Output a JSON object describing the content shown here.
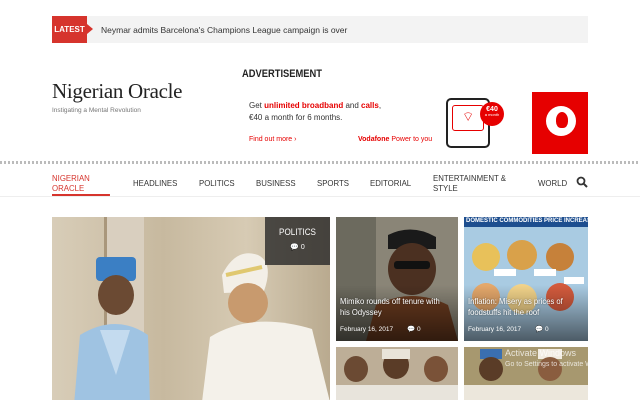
{
  "ticker": {
    "label": "LATEST",
    "headline": "Neymar admits Barcelona's Champions League campaign is over"
  },
  "brand": {
    "name": "Nigerian Oracle",
    "tagline": "Instigating a Mental Revolution"
  },
  "advert": {
    "heading": "ADVERTISEMENT",
    "line1_prefix": "Get ",
    "line1_highlight1": "unlimited broadband",
    "line1_mid": " and ",
    "line1_highlight2": "calls",
    "line1_suffix": ",",
    "line2": "€40 a month for 6 months.",
    "find_more": "Find out more ›",
    "brand": "Vodafone",
    "slogan": "Power to you",
    "price": "€40",
    "price_sub": "a month"
  },
  "nav": {
    "items": [
      {
        "label": "NIGERIAN ORACLE",
        "active": true
      },
      {
        "label": "HEADLINES"
      },
      {
        "label": "POLITICS"
      },
      {
        "label": "BUSINESS"
      },
      {
        "label": "SPORTS"
      },
      {
        "label": "EDITORIAL"
      },
      {
        "label": "ENTERTAINMENT & STYLE"
      },
      {
        "label": "WORLD"
      }
    ]
  },
  "featured": {
    "category": "POLITICS",
    "comments": "0"
  },
  "tiles": [
    {
      "title": "Mimiko rounds off tenure with his Odyssey",
      "date": "February 16, 2017",
      "comments": "0"
    },
    {
      "title": "Inflation: Misery as prices of foodstuffs hit the roof",
      "date": "February 16, 2017",
      "comments": "0",
      "banner": "DOMESTIC COMMODITIES PRICE INCREASE"
    },
    {
      "title": ""
    },
    {
      "title": ""
    }
  ],
  "watermark": {
    "line1": "Activate Windows",
    "line2": "Go to Settings to activate Windows."
  },
  "colors": {
    "accent": "#d6342d",
    "vodafone": "#e60000"
  }
}
